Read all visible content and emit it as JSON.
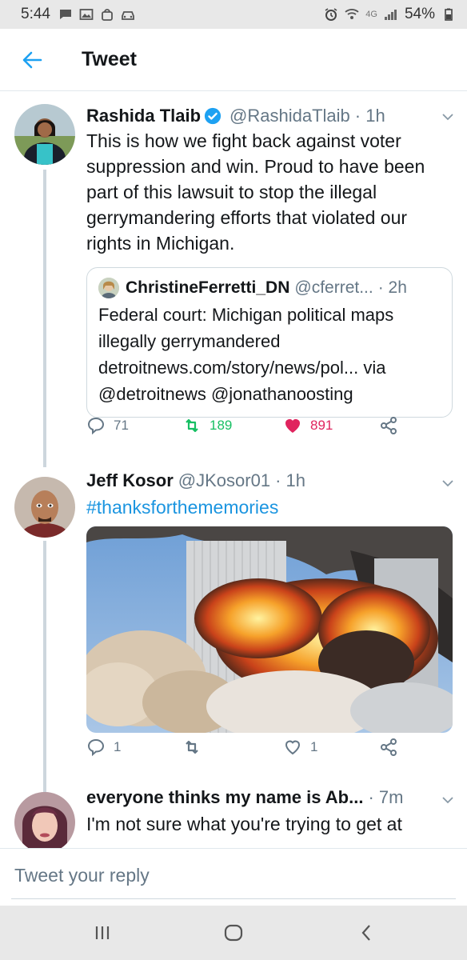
{
  "status_bar": {
    "time": "5:44",
    "network": "4G",
    "battery": "54%",
    "left_icons": [
      "message-icon",
      "image-icon",
      "bag-icon",
      "car-icon"
    ],
    "right_icons": [
      "alarm-icon",
      "wifi-icon",
      "signal-icon",
      "battery-icon"
    ]
  },
  "header": {
    "title": "Tweet"
  },
  "tweets": [
    {
      "name": "Rashida Tlaib",
      "verified": true,
      "handle": "@RashidaTlaib",
      "time": "· 1h",
      "text": "This is how we fight back against voter suppression and win. Proud to have been part of this lawsuit to stop the illegal gerrymandering efforts that violated our rights in Michigan.",
      "quote": {
        "name": "ChristineFerretti_DN",
        "handle": "@cferret...",
        "time": "· 2h",
        "text": "Federal court: Michigan political maps illegally gerrymandered detroitnews.com/story/news/pol... via @detroitnews @jonathanoosting"
      },
      "replies": "71",
      "retweets": "189",
      "likes": "891"
    },
    {
      "name": "Jeff Kosor",
      "handle": "@JKosor01",
      "time": "· 1h",
      "text": "#thanksforthememories",
      "replies": "1",
      "retweets": "",
      "likes": "1"
    },
    {
      "name": "everyone thinks my name is Ab...",
      "handle": "",
      "time": "· 7m",
      "text": "I'm not sure what you're trying to get at"
    }
  ],
  "reply_bar": {
    "placeholder": "Tweet your reply"
  },
  "colors": {
    "accent": "#1da1f2",
    "retweet": "#17bf63",
    "like": "#e0245e",
    "muted": "#657786"
  }
}
